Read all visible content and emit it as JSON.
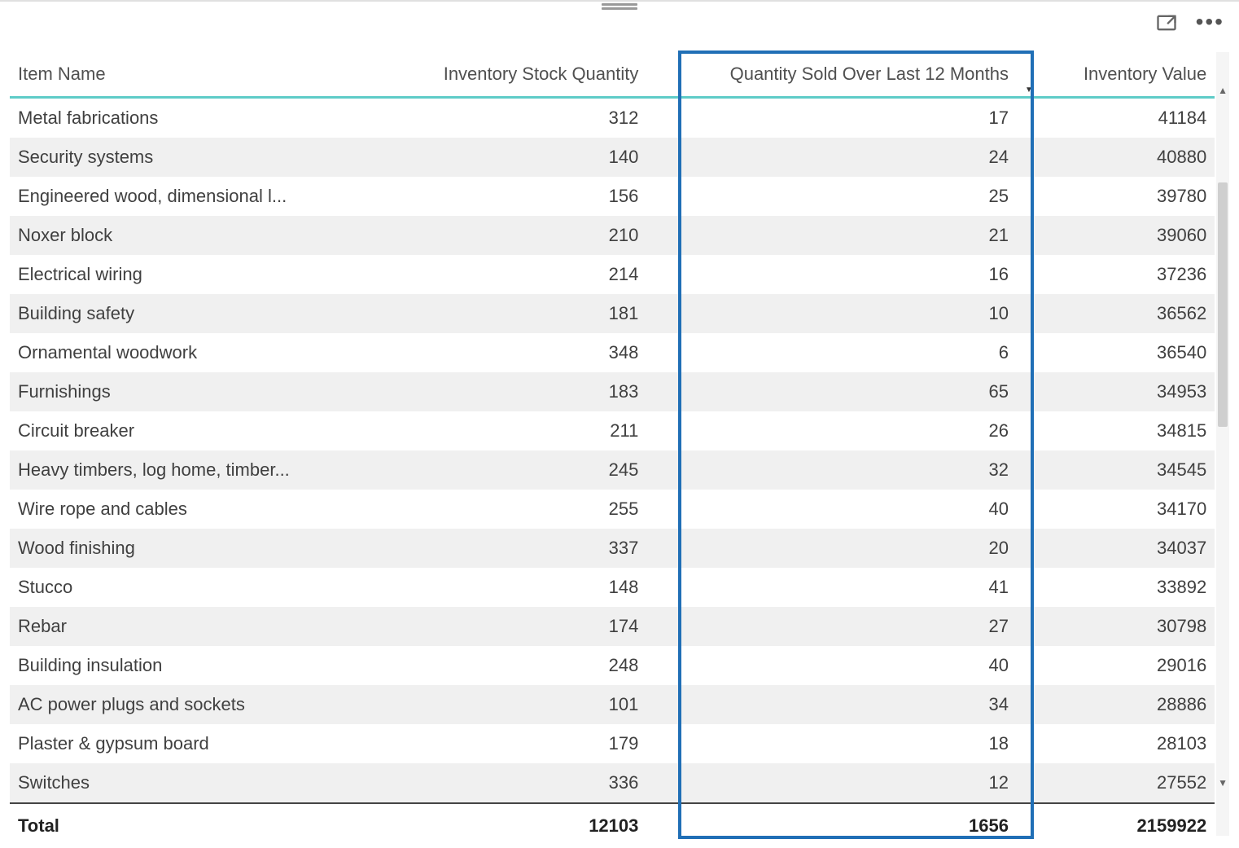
{
  "columns": {
    "item": "Item Name",
    "stock": "Inventory Stock Quantity",
    "sold": "Quantity Sold Over Last 12 Months",
    "value": "Inventory Value"
  },
  "sort_column": "value",
  "rows": [
    {
      "item": "Metal fabrications",
      "stock": 312,
      "sold": 17,
      "value": 41184
    },
    {
      "item": "Security systems",
      "stock": 140,
      "sold": 24,
      "value": 40880
    },
    {
      "item": "Engineered wood, dimensional l...",
      "stock": 156,
      "sold": 25,
      "value": 39780
    },
    {
      "item": "Noxer block",
      "stock": 210,
      "sold": 21,
      "value": 39060
    },
    {
      "item": "Electrical wiring",
      "stock": 214,
      "sold": 16,
      "value": 37236
    },
    {
      "item": "Building safety",
      "stock": 181,
      "sold": 10,
      "value": 36562
    },
    {
      "item": "Ornamental woodwork",
      "stock": 348,
      "sold": 6,
      "value": 36540
    },
    {
      "item": "Furnishings",
      "stock": 183,
      "sold": 65,
      "value": 34953
    },
    {
      "item": "Circuit breaker",
      "stock": 211,
      "sold": 26,
      "value": 34815
    },
    {
      "item": "Heavy timbers, log home, timber...",
      "stock": 245,
      "sold": 32,
      "value": 34545
    },
    {
      "item": "Wire rope and cables",
      "stock": 255,
      "sold": 40,
      "value": 34170
    },
    {
      "item": "Wood finishing",
      "stock": 337,
      "sold": 20,
      "value": 34037
    },
    {
      "item": "Stucco",
      "stock": 148,
      "sold": 41,
      "value": 33892
    },
    {
      "item": "Rebar",
      "stock": 174,
      "sold": 27,
      "value": 30798
    },
    {
      "item": "Building insulation",
      "stock": 248,
      "sold": 40,
      "value": 29016
    },
    {
      "item": "AC power plugs and sockets",
      "stock": 101,
      "sold": 34,
      "value": 28886
    },
    {
      "item": "Plaster & gypsum board",
      "stock": 179,
      "sold": 18,
      "value": 28103
    },
    {
      "item": "Switches",
      "stock": 336,
      "sold": 12,
      "value": 27552
    }
  ],
  "totals": {
    "label": "Total",
    "stock": 12103,
    "sold": 1656,
    "value": 2159922
  },
  "highlighted_column": "sold"
}
